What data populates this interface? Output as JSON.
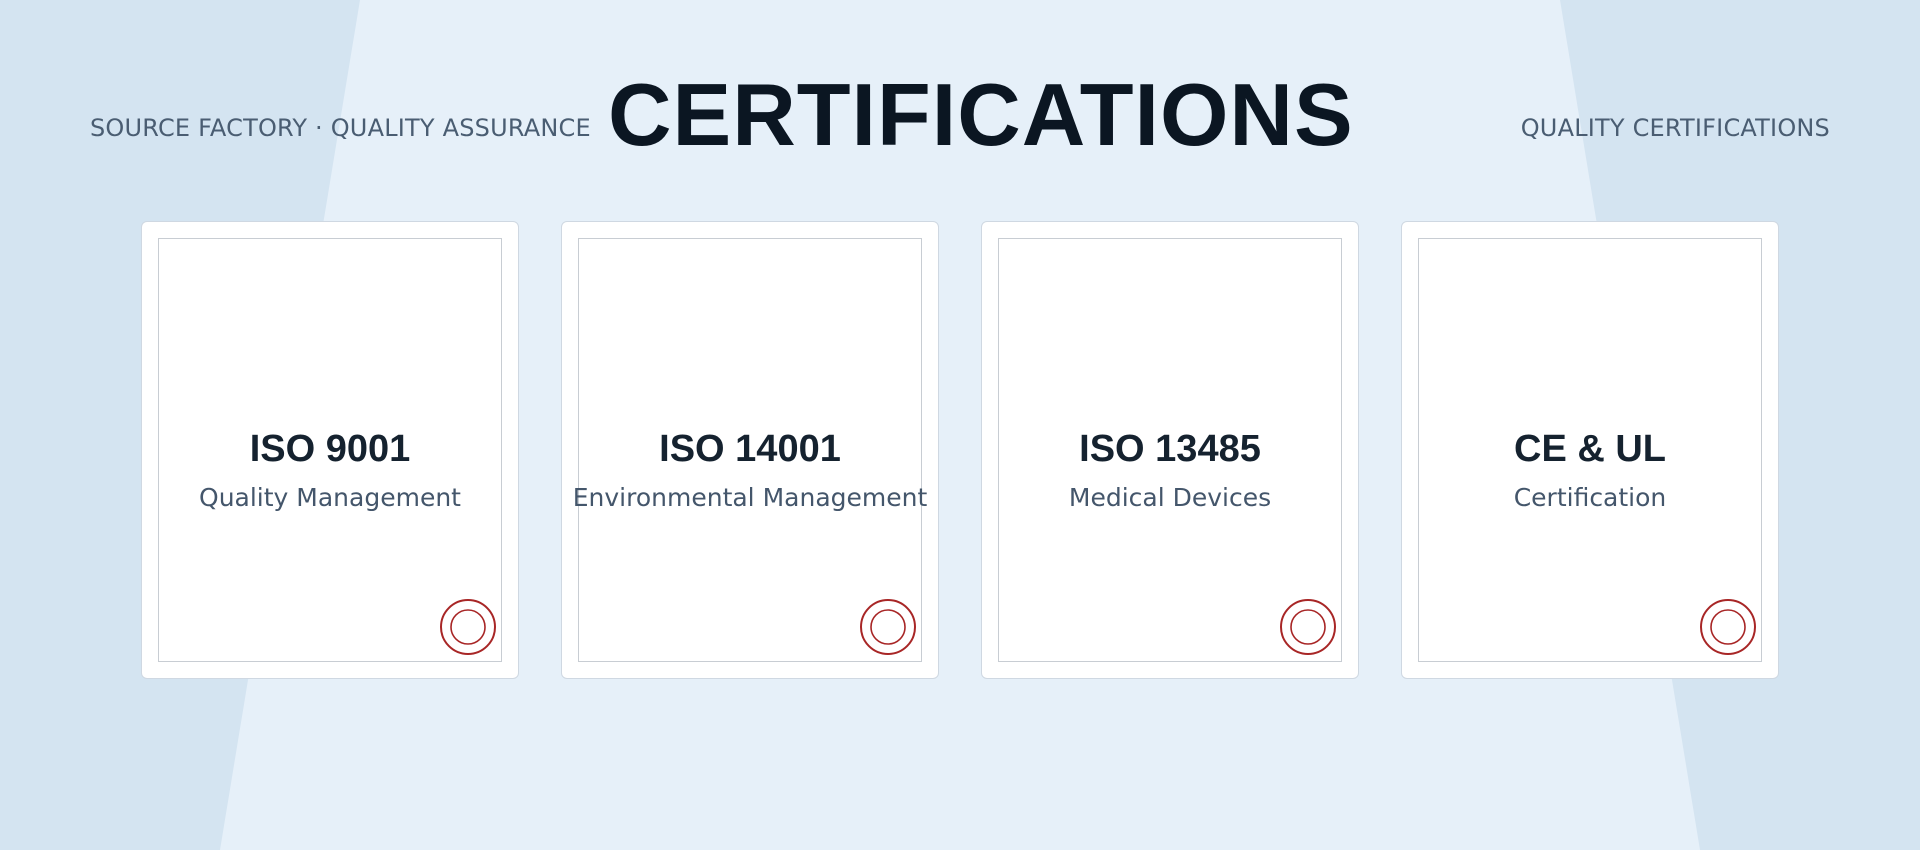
{
  "header": {
    "eyebrow_left": "SOURCE FACTORY · QUALITY ASSURANCE",
    "title": "CERTIFICATIONS",
    "eyebrow_right": "QUALITY CERTIFICATIONS"
  },
  "cards": [
    {
      "title": "ISO 9001",
      "subtitle": "Quality Management",
      "seal_icon": "seal-icon"
    },
    {
      "title": "ISO 14001",
      "subtitle": "Environmental Management",
      "seal_icon": "seal-icon"
    },
    {
      "title": "ISO 13485",
      "subtitle": "Medical Devices",
      "seal_icon": "seal-icon"
    },
    {
      "title": "CE & UL",
      "subtitle": "Certification",
      "seal_icon": "seal-icon"
    }
  ],
  "colors": {
    "background": "#d4e4f1",
    "background_panel": "#e6f0f9",
    "title": "#0b1622",
    "text_muted": "#4a5d72",
    "seal": "#a82626"
  }
}
